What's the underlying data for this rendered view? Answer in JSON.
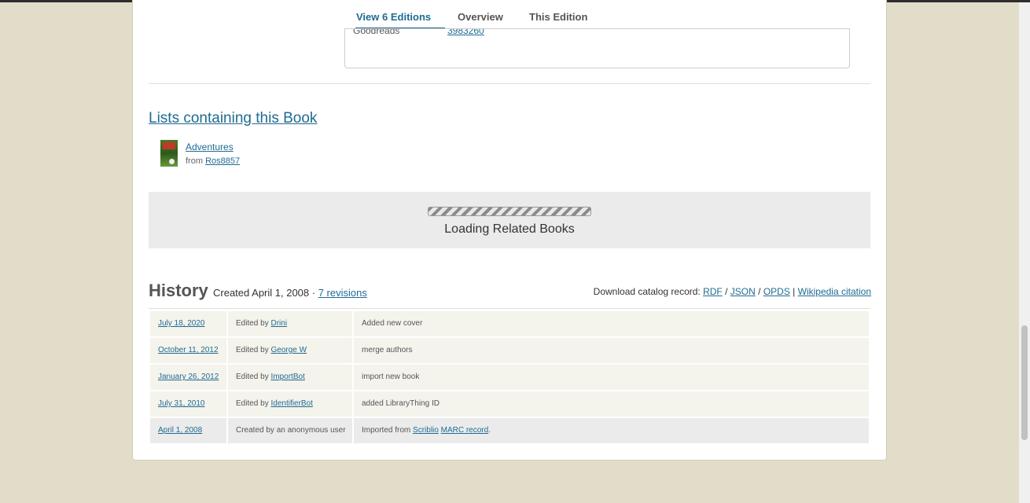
{
  "tabs": [
    {
      "label": "View 6 Editions"
    },
    {
      "label": "Overview"
    },
    {
      "label": "This Edition"
    }
  ],
  "identifiers": {
    "label": "Goodreads",
    "value": "3983260"
  },
  "lists": {
    "title": "Lists containing this Book",
    "items": [
      {
        "name": "Adventures",
        "from_prefix": "from",
        "owner": "Ros8857"
      }
    ]
  },
  "related": {
    "loading_text": "Loading Related Books"
  },
  "history": {
    "title": "History",
    "created": "Created April 1, 2008 ·",
    "revisions": "7 revisions",
    "download_prefix": "Download catalog record:",
    "rdf": "RDF",
    "json": "JSON",
    "opds": "OPDS",
    "wikipedia": "Wikipedia citation",
    "rows": [
      {
        "date": "July 18, 2020",
        "who_prefix": "Edited by",
        "who": "Drini",
        "comment": "Added new cover"
      },
      {
        "date": "October 11, 2012",
        "who_prefix": "Edited by",
        "who": "George W",
        "comment": "merge authors"
      },
      {
        "date": "January 26, 2012",
        "who_prefix": "Edited by",
        "who": "ImportBot",
        "comment": "import new book"
      },
      {
        "date": "July 31, 2010",
        "who_prefix": "Edited by",
        "who": "IdentifierBot",
        "comment": "added LibraryThing ID"
      },
      {
        "date": "April 1, 2008",
        "who_prefix": "Created by an anonymous user",
        "comment_prefix": "Imported from",
        "link1": "Scriblio",
        "link2": "MARC record"
      }
    ]
  }
}
